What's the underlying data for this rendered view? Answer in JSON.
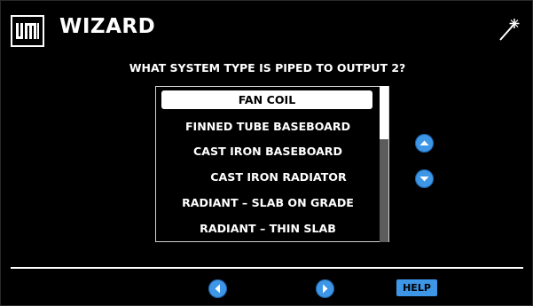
{
  "header": {
    "title": "WIZARD",
    "logo_icon": "logo-icon",
    "wand_icon": "magic-wand-icon"
  },
  "question": "WHAT SYSTEM TYPE IS PIPED TO OUTPUT 2?",
  "options": [
    {
      "label": "FAN COIL",
      "selected": true
    },
    {
      "label": "FINNED TUBE BASEBOARD",
      "selected": false
    },
    {
      "label": "CAST IRON BASEBOARD",
      "selected": false
    },
    {
      "label": "CAST IRON RADIATOR",
      "selected": false
    },
    {
      "label": "RADIANT – SLAB ON GRADE",
      "selected": false
    },
    {
      "label": "RADIANT – THIN SLAB",
      "selected": false
    }
  ],
  "controls": {
    "scroll_up_icon": "chevron-up-icon",
    "scroll_down_icon": "chevron-down-icon",
    "back_icon": "chevron-left-icon",
    "next_icon": "chevron-right-icon",
    "help_label": "HELP"
  },
  "colors": {
    "background": "#000000",
    "accent": "#3d96e6",
    "text": "#ffffff"
  }
}
